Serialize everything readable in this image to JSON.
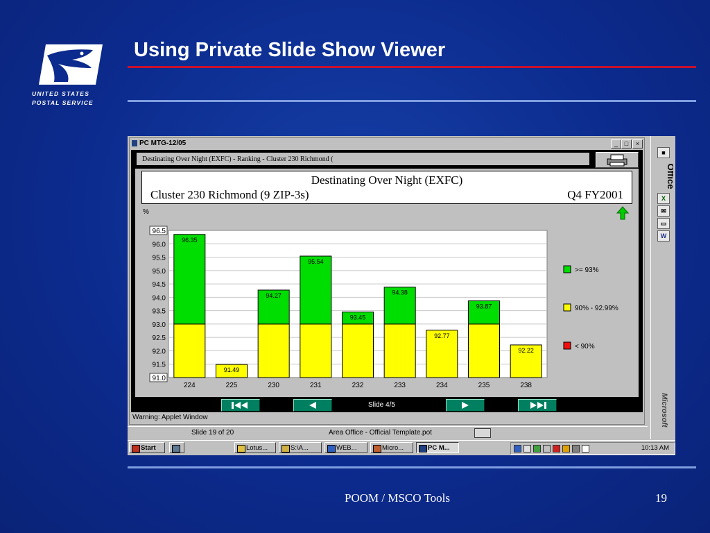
{
  "slide": {
    "title": "Using Private Slide Show Viewer",
    "footer": "POOM / MSCO Tools",
    "number": "19",
    "logo_line1": "UNITED STATES",
    "logo_line2": "POSTAL SERVICE"
  },
  "applet_window": {
    "title": "PC MTG-12/05",
    "banner": "Destinating Over Night (EXFC) - Ranking - Cluster 230 Richmond (",
    "header_title": "Destinating Over Night (EXFC)",
    "header_left": "Cluster 230 Richmond (9 ZIP-3s)",
    "header_right": "Q4 FY2001",
    "unit_label": "%",
    "slide_label": "Slide 4/5",
    "warning": "Warning: Applet Window",
    "controls": {
      "minimize": "_",
      "maximize": "□",
      "close": "×"
    }
  },
  "chart_data": {
    "type": "bar",
    "categories": [
      "224",
      "225",
      "230",
      "231",
      "232",
      "233",
      "234",
      "235",
      "238"
    ],
    "values": [
      96.35,
      91.49,
      94.27,
      95.54,
      93.45,
      94.38,
      92.77,
      93.87,
      92.22
    ],
    "value_labels": [
      "96.35",
      "91.49",
      "94.27",
      "95.54",
      "93.45",
      "94.38",
      "92.77",
      "93.87",
      "92.22"
    ],
    "ylim": [
      91.0,
      96.5
    ],
    "yticks": [
      "96.5",
      "96.0",
      "95.5",
      "95.0",
      "94.5",
      "94.0",
      "93.5",
      "93.0",
      "92.5",
      "92.0",
      "91.5",
      "91.0"
    ],
    "thresholds": {
      "green_min": 93.0,
      "yellow_min": 90.0
    },
    "legend": [
      {
        "label": ">= 93%",
        "color": "#00dd00"
      },
      {
        "label": "90% - 92.99%",
        "color": "#ffff00"
      },
      {
        "label": "< 90%",
        "color": "#ee1111"
      }
    ],
    "grid": true,
    "legend_position": "right"
  },
  "powerpoint_status": {
    "slide_count": "Slide 19 of 20",
    "template": "Area Office - Official Template.pot"
  },
  "taskbar": {
    "start": "Start",
    "tasks": [
      "Lotus...",
      "S:\\A...",
      "WEB...",
      "Micro...",
      "PC M..."
    ],
    "clock": "10:13 AM"
  },
  "office_bar": {
    "label": "Office",
    "ms_label": "Microsoft"
  },
  "colors": {
    "slide_background": "#0c2b8e",
    "rule_red": "#c8102e",
    "nav_button": "#008060",
    "bar_green": "#00dd00",
    "bar_yellow": "#ffff00"
  }
}
